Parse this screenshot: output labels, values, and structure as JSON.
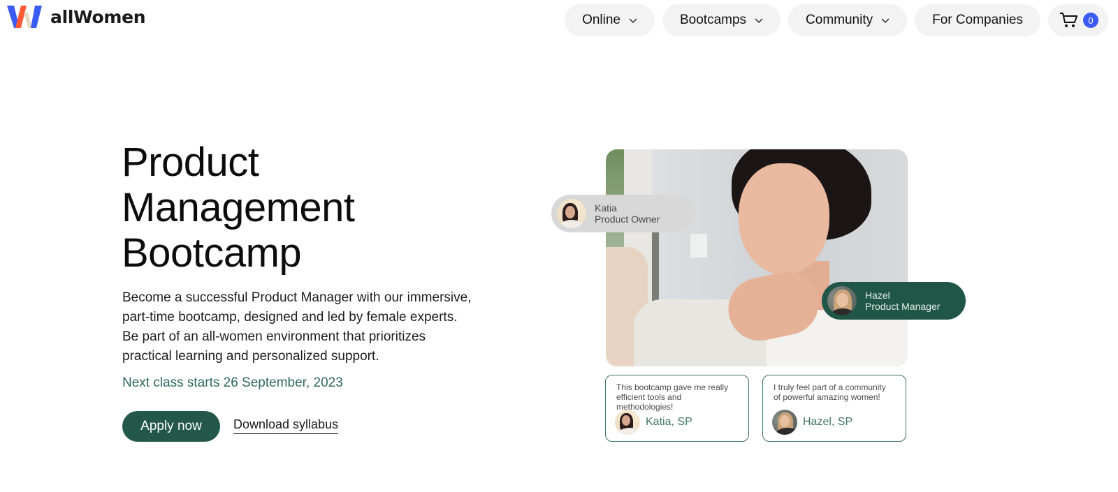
{
  "brand": {
    "name": "allWomen",
    "colors": {
      "logo_blue": "#3b5bf5",
      "logo_orange": "#ff5a36",
      "logo_beige": "#e6d9c4",
      "primary_green": "#235748",
      "accent_green": "#2f6a5a",
      "badge_blue": "#3b5bf5"
    }
  },
  "nav": {
    "items": [
      {
        "label": "Online",
        "has_dropdown": true,
        "icon": "chevron-down-icon"
      },
      {
        "label": "Bootcamps",
        "has_dropdown": true,
        "icon": "chevron-down-icon"
      },
      {
        "label": "Community",
        "has_dropdown": true,
        "icon": "chevron-down-icon"
      },
      {
        "label": "For Companies",
        "has_dropdown": false
      }
    ],
    "cart": {
      "icon": "shopping-cart-icon",
      "count": "0"
    }
  },
  "hero": {
    "title_lines": [
      "Product",
      "Management",
      "Bootcamp"
    ],
    "description": "Become a successful Product Manager with our immersive, part-time bootcamp, designed and led by female experts. Be part of an all-women environment that prioritizes practical learning and personalized support.",
    "next_class": "Next class starts 26 September, 2023",
    "apply_label": "Apply now",
    "download_label": "Download syllabus"
  },
  "profiles": [
    {
      "name": "Katia",
      "role": "Product Owner"
    },
    {
      "name": "Hazel",
      "role": "Product Manager"
    }
  ],
  "reviews": [
    {
      "text": "This bootcamp gave me really efficient tools and methodologies!",
      "author": "Katia, SP"
    },
    {
      "text": "I truly feel part of a community of powerful amazing women!",
      "author": "Hazel, SP"
    }
  ]
}
